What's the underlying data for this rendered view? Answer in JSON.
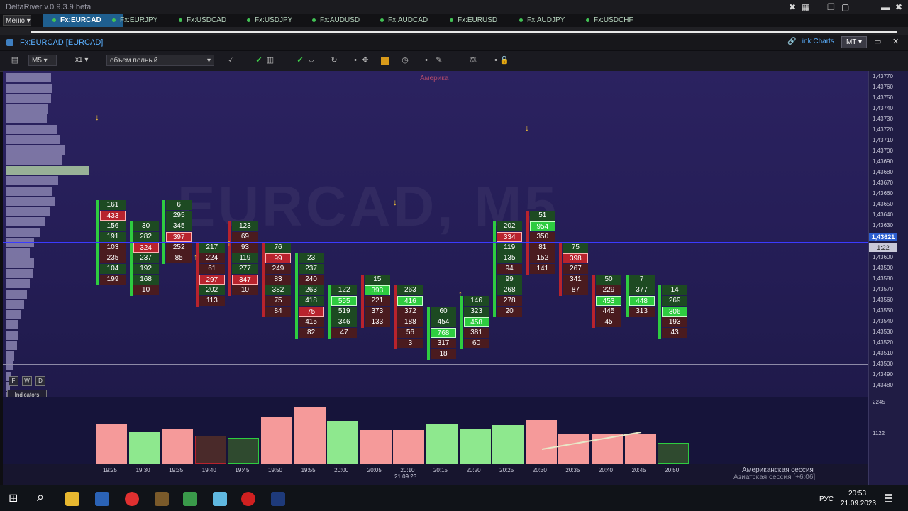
{
  "window": {
    "title": "DeltaRiver v.0.9.3.9 beta"
  },
  "tabs": {
    "menu_label": "Меню",
    "items": [
      "Fx:EURCAD",
      "Fx:EURJPY",
      "Fx:USDCAD",
      "Fx:USDJPY",
      "Fx:AUDUSD",
      "Fx:AUDCAD",
      "Fx:EURUSD",
      "Fx:AUDJPY",
      "Fx:USDCHF"
    ],
    "active": "Fx:EURCAD"
  },
  "chart_window": {
    "name": "Fx:EURCAD [EURCAD]",
    "link_charts": "Link Charts",
    "mt_label": "MT"
  },
  "toolbar": {
    "timeframe": "M5",
    "scale": "x1",
    "volume_mode": "объем полный"
  },
  "plot": {
    "watermark": "EURCAD, M5",
    "session_top": "Америка",
    "current_price": "1,43621",
    "candle_timer": "1:22",
    "level_price": "1,43500",
    "buttons": {
      "f": "F",
      "w": "W",
      "d": "D",
      "indicators": "Indicators"
    },
    "session_bottom_1": "Американская сессия",
    "session_bottom_2": "Азиатская сессия [+6:06]",
    "date_label": "21.09.23"
  },
  "colors": {
    "buy": "#2ecc40",
    "sell": "#b8232d",
    "bg": "#2b2260",
    "accent": "#1f5f8f"
  },
  "chart_data": {
    "type": "table",
    "y_ticks": [
      "1,43770",
      "1,43760",
      "1,43750",
      "1,43740",
      "1,43730",
      "1,43720",
      "1,43710",
      "1,43700",
      "1,43690",
      "1,43680",
      "1,43670",
      "1,43660",
      "1,43650",
      "1,43640",
      "1,43630",
      "1,43620",
      "1,43610",
      "1,43600",
      "1,43590",
      "1,43580",
      "1,43570",
      "1,43560",
      "1,43550",
      "1,43540",
      "1,43530",
      "1,43520",
      "1,43510",
      "1,43500",
      "1,43490",
      "1,43480"
    ],
    "x_ticks": [
      "19:25",
      "19:30",
      "19:35",
      "19:40",
      "19:45",
      "19:50",
      "19:55",
      "20:00",
      "20:05",
      "20:10",
      "20:15",
      "20:20",
      "20:25",
      "20:30",
      "20:35",
      "20:40",
      "20:45",
      "20:50"
    ],
    "volume_ticks": [
      "2245",
      "1122"
    ],
    "volume_bars": [
      {
        "t": "19:25",
        "v": 1370,
        "c": "sell"
      },
      {
        "t": "19:30",
        "v": 1090,
        "c": "buy"
      },
      {
        "t": "19:35",
        "v": 1220,
        "c": "sell"
      },
      {
        "t": "19:40",
        "v": 980,
        "c": "sell-dim"
      },
      {
        "t": "19:45",
        "v": 900,
        "c": "buy-dim"
      },
      {
        "t": "19:50",
        "v": 1630,
        "c": "sell"
      },
      {
        "t": "19:55",
        "v": 1980,
        "c": "sell"
      },
      {
        "t": "20:00",
        "v": 1480,
        "c": "buy"
      },
      {
        "t": "20:05",
        "v": 1180,
        "c": "sell"
      },
      {
        "t": "20:10",
        "v": 1160,
        "c": "sell"
      },
      {
        "t": "20:15",
        "v": 1400,
        "c": "buy"
      },
      {
        "t": "20:20",
        "v": 1210,
        "c": "buy"
      },
      {
        "t": "20:25",
        "v": 1340,
        "c": "buy"
      },
      {
        "t": "20:30",
        "v": 1520,
        "c": "sell"
      },
      {
        "t": "20:35",
        "v": 1040,
        "c": "sell"
      },
      {
        "t": "20:40",
        "v": 1060,
        "c": "sell"
      },
      {
        "t": "20:45",
        "v": 1020,
        "c": "sell"
      },
      {
        "t": "20:50",
        "v": 720,
        "c": "buy-dim"
      }
    ],
    "footprints": [
      {
        "t": "19:25",
        "top_row": 6,
        "cells": [
          [
            "161",
            "g"
          ],
          [
            "433",
            "br"
          ],
          [
            "156",
            "g"
          ],
          [
            "191",
            "g"
          ],
          [
            "103",
            "r"
          ],
          [
            "235",
            "r"
          ],
          [
            "104",
            "g"
          ],
          [
            "199",
            "r"
          ]
        ]
      },
      {
        "t": "19:30",
        "top_row": 8,
        "cells": [
          [
            "30",
            "g"
          ],
          [
            "282",
            "g"
          ],
          [
            "324",
            "br"
          ],
          [
            "237",
            "g"
          ],
          [
            "192",
            "g"
          ],
          [
            "168",
            "g"
          ],
          [
            "10",
            "r"
          ]
        ]
      },
      {
        "t": "19:35",
        "top_row": 6,
        "cells": [
          [
            "6",
            "g"
          ],
          [
            "295",
            "g"
          ],
          [
            "345",
            "g"
          ],
          [
            "397",
            "br"
          ],
          [
            "252",
            "r"
          ],
          [
            "85",
            "r"
          ]
        ]
      },
      {
        "t": "19:40",
        "top_row": 10,
        "cells": [
          [
            "217",
            "g"
          ],
          [
            "224",
            "r"
          ],
          [
            "61",
            "r"
          ],
          [
            "297",
            "br"
          ],
          [
            "202",
            "g"
          ],
          [
            "113",
            "r"
          ]
        ]
      },
      {
        "t": "19:45",
        "top_row": 8,
        "cells": [
          [
            "123",
            "g"
          ],
          [
            "69",
            "r"
          ],
          [
            "93",
            "r"
          ],
          [
            "119",
            "g"
          ],
          [
            "277",
            "g"
          ],
          [
            "347",
            "br"
          ],
          [
            "10",
            "r"
          ]
        ]
      },
      {
        "t": "19:50",
        "top_row": 10,
        "cells": [
          [
            "76",
            "g"
          ],
          [
            "99",
            "br"
          ],
          [
            "249",
            "r"
          ],
          [
            "83",
            "r"
          ],
          [
            "382",
            "g"
          ],
          [
            "75",
            "r"
          ],
          [
            "84",
            "r"
          ]
        ]
      },
      {
        "t": "19:55",
        "top_row": 11,
        "cells": [
          [
            "23",
            "g"
          ],
          [
            "237",
            "g"
          ],
          [
            "240",
            "r"
          ],
          [
            "263",
            "g"
          ],
          [
            "418",
            "g"
          ],
          [
            "75",
            "br"
          ],
          [
            "415",
            "r"
          ],
          [
            "82",
            "r"
          ]
        ]
      },
      {
        "t": "20:00",
        "top_row": 14,
        "cells": [
          [
            "122",
            "g"
          ],
          [
            "555",
            "bg"
          ],
          [
            "519",
            "g"
          ],
          [
            "346",
            "g"
          ],
          [
            "47",
            "r"
          ]
        ]
      },
      {
        "t": "20:05",
        "top_row": 13,
        "cells": [
          [
            "15",
            "g"
          ],
          [
            "393",
            "bg"
          ],
          [
            "221",
            "r"
          ],
          [
            "373",
            "r"
          ],
          [
            "133",
            "r"
          ]
        ]
      },
      {
        "t": "20:10",
        "top_row": 14,
        "cells": [
          [
            "263",
            "g"
          ],
          [
            "416",
            "bg"
          ],
          [
            "372",
            "r"
          ],
          [
            "188",
            "r"
          ],
          [
            "56",
            "r"
          ],
          [
            "3",
            "r"
          ]
        ]
      },
      {
        "t": "20:15",
        "top_row": 16,
        "cells": [
          [
            "60",
            "g"
          ],
          [
            "454",
            "g"
          ],
          [
            "768",
            "bg"
          ],
          [
            "317",
            "r"
          ],
          [
            "18",
            "r"
          ]
        ]
      },
      {
        "t": "20:20",
        "top_row": 15,
        "cells": [
          [
            "146",
            "g"
          ],
          [
            "323",
            "g"
          ],
          [
            "458",
            "bg"
          ],
          [
            "381",
            "r"
          ],
          [
            "60",
            "r"
          ]
        ]
      },
      {
        "t": "20:25",
        "top_row": 8,
        "cells": [
          [
            "202",
            "g"
          ],
          [
            "334",
            "br"
          ],
          [
            "119",
            "g"
          ],
          [
            "135",
            "g"
          ],
          [
            "94",
            "r"
          ],
          [
            "99",
            "g"
          ],
          [
            "268",
            "g"
          ],
          [
            "278",
            "r"
          ],
          [
            "20",
            "r"
          ]
        ]
      },
      {
        "t": "20:30",
        "top_row": 7,
        "cells": [
          [
            "51",
            "g"
          ],
          [
            "954",
            "bg"
          ],
          [
            "350",
            "r"
          ],
          [
            "81",
            "r"
          ],
          [
            "152",
            "r"
          ],
          [
            "141",
            "r"
          ]
        ]
      },
      {
        "t": "20:35",
        "top_row": 10,
        "cells": [
          [
            "75",
            "g"
          ],
          [
            "398",
            "br"
          ],
          [
            "267",
            "r"
          ],
          [
            "341",
            "r"
          ],
          [
            "87",
            "r"
          ]
        ]
      },
      {
        "t": "20:40",
        "top_row": 13,
        "cells": [
          [
            "50",
            "g"
          ],
          [
            "229",
            "r"
          ],
          [
            "453",
            "bg"
          ],
          [
            "445",
            "r"
          ],
          [
            "45",
            "r"
          ]
        ]
      },
      {
        "t": "20:45",
        "top_row": 13,
        "cells": [
          [
            "7",
            "g"
          ],
          [
            "377",
            "g"
          ],
          [
            "448",
            "bg"
          ],
          [
            "313",
            "r"
          ]
        ]
      },
      {
        "t": "20:50",
        "top_row": 14,
        "cells": [
          [
            "14",
            "g"
          ],
          [
            "269",
            "g"
          ],
          [
            "306",
            "bg"
          ],
          [
            "193",
            "r"
          ],
          [
            "43",
            "r"
          ]
        ]
      }
    ]
  },
  "taskbar": {
    "lang": "РУС",
    "time": "20:53",
    "date": "21.09.2023"
  }
}
